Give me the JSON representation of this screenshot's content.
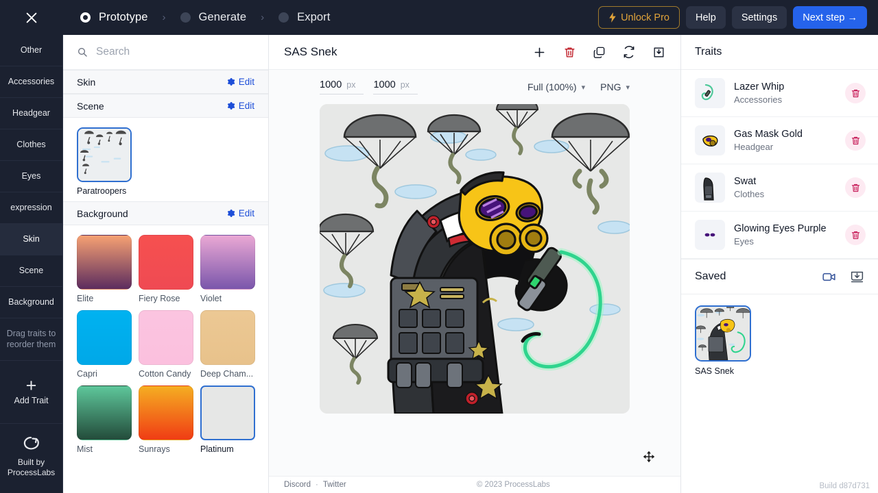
{
  "header": {
    "close_icon": "close-icon",
    "breadcrumbs": [
      {
        "label": "Prototype",
        "active": true
      },
      {
        "label": "Generate",
        "active": false
      },
      {
        "label": "Export",
        "active": false
      }
    ],
    "separator": "›",
    "unlock_pro_label": "Unlock Pro",
    "unlock_pro_icon": "bolt-icon",
    "help_label": "Help",
    "settings_label": "Settings",
    "next_step_label": "Next step →",
    "accent_primary": "#2563eb",
    "accent_pro": "#e0a33a",
    "bar_bg": "#1b2130"
  },
  "rail": {
    "items": [
      {
        "label": "Other",
        "active": false
      },
      {
        "label": "Accessories",
        "active": false
      },
      {
        "label": "Headgear",
        "active": false
      },
      {
        "label": "Clothes",
        "active": false
      },
      {
        "label": "Eyes",
        "active": false
      },
      {
        "label": "expression",
        "active": false
      },
      {
        "label": "Skin",
        "active": true
      },
      {
        "label": "Scene",
        "active": false
      },
      {
        "label": "Background",
        "active": false
      }
    ],
    "hint": "Drag traits to reorder them",
    "add_trait_label": "Add Trait",
    "add_trait_icon": "plus-icon",
    "built_by_label": "Built by ProcessLabs",
    "built_by_icon": "loop-logo-icon"
  },
  "picker": {
    "search_placeholder": "Search",
    "search_value": "",
    "search_icon": "search-icon",
    "edit_label": "Edit",
    "edit_icon": "gear-icon",
    "sections": [
      {
        "title": "Skin",
        "items": []
      },
      {
        "title": "Scene",
        "items": [
          {
            "name": "Paratroopers",
            "selected": true,
            "kind": "scene"
          }
        ]
      },
      {
        "title": "Background",
        "items": [
          {
            "name": "Elite",
            "selected": false,
            "kind": "swatch",
            "from": "#f6a173",
            "to": "#5c2c5e"
          },
          {
            "name": "Fiery Rose",
            "selected": false,
            "kind": "swatch",
            "from": "#f6504f",
            "to": "#ef4a53"
          },
          {
            "name": "Violet",
            "selected": false,
            "kind": "swatch",
            "from": "#eaa8d4",
            "to": "#7a56ab"
          },
          {
            "name": "Capri",
            "selected": false,
            "kind": "swatch",
            "from": "#00b2f0",
            "to": "#00a8e8"
          },
          {
            "name": "Cotton Candy",
            "selected": false,
            "kind": "swatch",
            "from": "#fbc4e0",
            "to": "#fbc0de"
          },
          {
            "name": "Deep Cham...",
            "selected": false,
            "kind": "swatch",
            "from": "#ecc894",
            "to": "#e8c28b"
          },
          {
            "name": "Mist",
            "selected": false,
            "kind": "swatch",
            "from": "#5ec79b",
            "to": "#234b3a"
          },
          {
            "name": "Sunrays",
            "selected": false,
            "kind": "swatch",
            "from": "#f5ae22",
            "to": "#f03c14"
          },
          {
            "name": "Platinum",
            "selected": true,
            "kind": "swatch",
            "from": "#e6e7e6",
            "to": "#e6e7e6"
          }
        ]
      }
    ]
  },
  "canvas": {
    "title": "SAS Snek",
    "actions": [
      {
        "icon": "plus-icon",
        "name": "add-item-button"
      },
      {
        "icon": "trash-icon",
        "name": "delete-button"
      },
      {
        "icon": "duplicate-icon",
        "name": "duplicate-button"
      },
      {
        "icon": "refresh-icon",
        "name": "randomize-button"
      },
      {
        "icon": "download-icon",
        "name": "save-button"
      }
    ],
    "width_value": "1000",
    "width_unit": "px",
    "height_value": "1000",
    "height_unit": "px",
    "quality_value": "Full (100%)",
    "format_value": "PNG",
    "caret": "⌄",
    "move_icon": "move-handle-icon",
    "artwork_alt": "SAS Snek"
  },
  "footer": {
    "discord_label": "Discord",
    "dot": "·",
    "twitter_label": "Twitter",
    "copyright": "© 2023 ProcessLabs",
    "build": "Build d87d731"
  },
  "traits_panel": {
    "title": "Traits",
    "delete_icon": "trash-icon",
    "rows": [
      {
        "name": "Lazer Whip",
        "category": "Accessories",
        "thumb": "lazer-whip"
      },
      {
        "name": "Gas Mask Gold",
        "category": "Headgear",
        "thumb": "gas-mask"
      },
      {
        "name": "Swat",
        "category": "Clothes",
        "thumb": "swat"
      },
      {
        "name": "Glowing Eyes Purple",
        "category": "Eyes",
        "thumb": "eyes"
      }
    ],
    "saved_title": "Saved",
    "saved_icons": [
      {
        "icon": "video-icon",
        "name": "record-video-button"
      },
      {
        "icon": "download-all-icon",
        "name": "download-saved-button"
      }
    ],
    "saved_items": [
      {
        "name": "SAS Snek",
        "selected": true
      }
    ]
  }
}
